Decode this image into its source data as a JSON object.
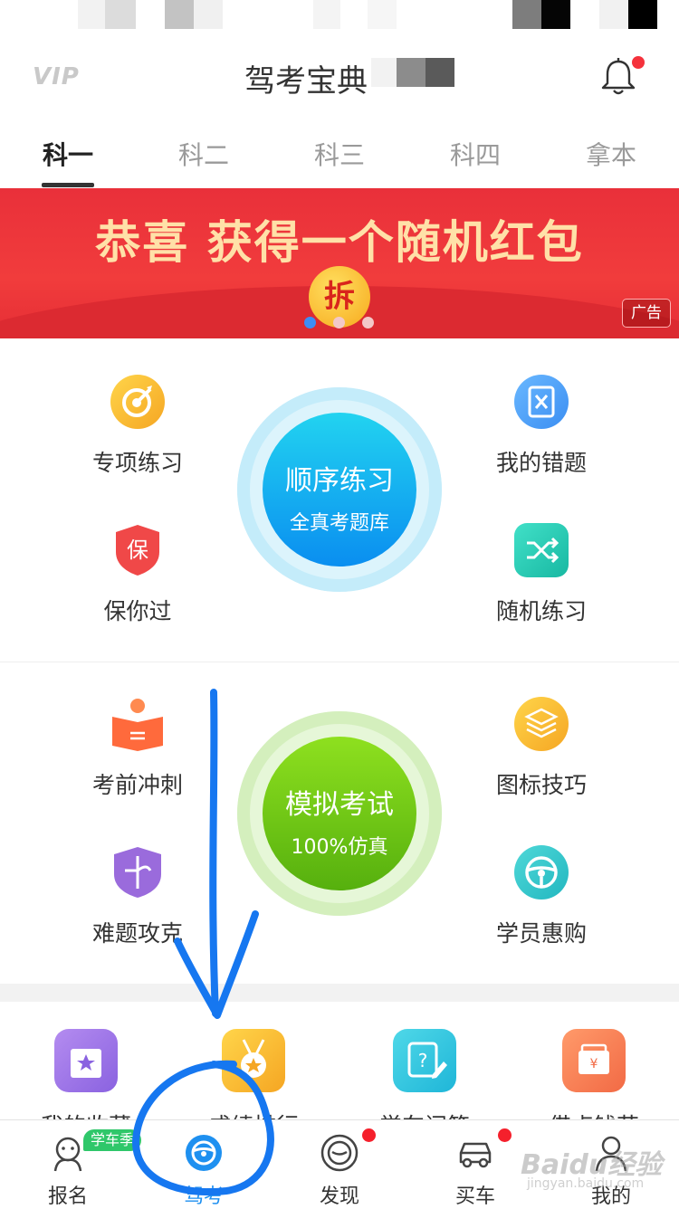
{
  "header": {
    "vip": "VIP",
    "title": "驾考宝典"
  },
  "tabs": [
    "科一",
    "科二",
    "科三",
    "科四",
    "拿本"
  ],
  "banner": {
    "text": "恭喜 获得一个随机红包",
    "coin": "拆",
    "ad_label": "广告"
  },
  "section1": {
    "left": [
      {
        "label": "专项练习",
        "icon": "target-icon"
      },
      {
        "label": "保你过",
        "icon": "shield-icon",
        "glyph": "保"
      }
    ],
    "center": {
      "title": "顺序练习",
      "subtitle": "全真考题库"
    },
    "right": [
      {
        "label": "我的错题",
        "icon": "wrong-questions-icon"
      },
      {
        "label": "随机练习",
        "icon": "shuffle-icon"
      }
    ]
  },
  "section2": {
    "left": [
      {
        "label": "考前冲刺",
        "icon": "book-icon"
      },
      {
        "label": "难题攻克",
        "icon": "puzzle-shield-icon"
      }
    ],
    "center": {
      "title": "模拟考试",
      "subtitle": "100%仿真"
    },
    "right": [
      {
        "label": "图标技巧",
        "icon": "layers-icon"
      },
      {
        "label": "学员惠购",
        "icon": "steering-wheel-icon"
      }
    ]
  },
  "section3": [
    {
      "label": "我的收藏",
      "icon": "favorites-icon"
    },
    {
      "label": "成绩排行",
      "icon": "medal-icon"
    },
    {
      "label": "学车问答",
      "icon": "qa-icon"
    },
    {
      "label": "借点钱花",
      "icon": "wallet-icon"
    }
  ],
  "tabbar": [
    {
      "label": "报名",
      "icon": "signup-icon",
      "badge": "学车季"
    },
    {
      "label": "驾考",
      "icon": "steering-wheel-icon",
      "active": true
    },
    {
      "label": "发现",
      "icon": "discover-icon"
    },
    {
      "label": "买车",
      "icon": "car-icon"
    },
    {
      "label": "我的",
      "icon": "profile-icon"
    }
  ],
  "watermark": {
    "text": "Baidu经验",
    "sub": "jingyan.baidu.com"
  },
  "colors": {
    "accent_blue": "#1e90f0",
    "banner_red": "#e9303a",
    "exam_green": "#6ec21a",
    "practice_cyan": "#19b6f0"
  }
}
